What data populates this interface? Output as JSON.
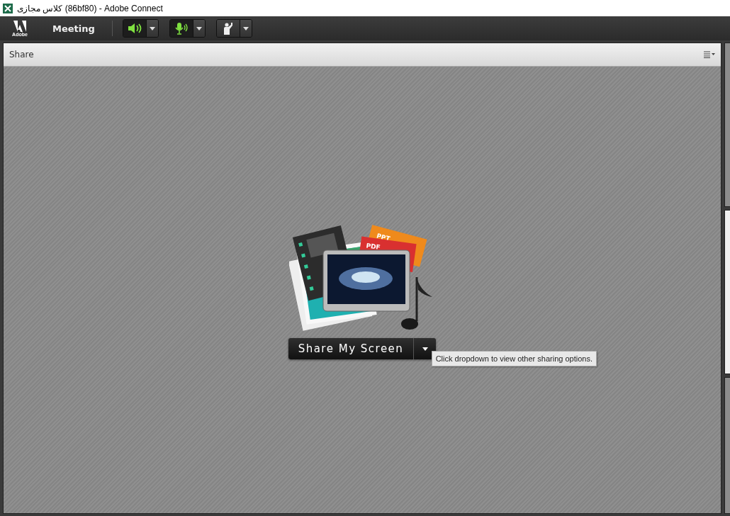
{
  "window": {
    "title": "کلاس مجازی (86bf80) - Adobe Connect"
  },
  "toolbar": {
    "logo_text": "Adobe",
    "menu": "Meeting",
    "controls": [
      {
        "kind": "speaker",
        "on": true
      },
      {
        "kind": "microphone",
        "on": true
      },
      {
        "kind": "hand",
        "on": false
      }
    ]
  },
  "share_pod": {
    "title": "Share",
    "button": "Share My Screen",
    "tooltip": "Click dropdown to view other sharing options.",
    "badges": [
      "PPT",
      "PDF"
    ]
  }
}
